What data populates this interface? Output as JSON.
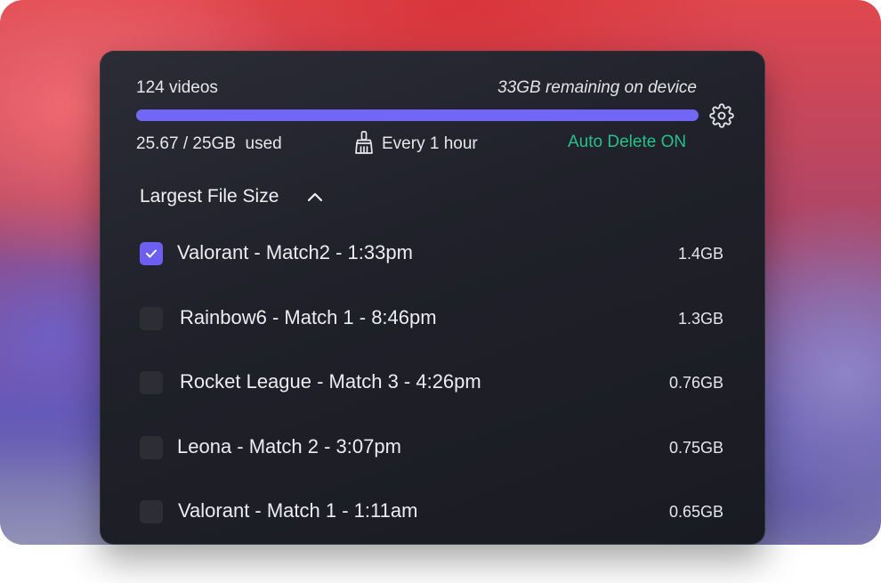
{
  "storage": {
    "video_count": "124 videos",
    "remaining": "33GB remaining on device",
    "used": "25.67 / 25GB  used",
    "usage_fraction": 1.0,
    "bar_color": "#7266f6"
  },
  "cleanup": {
    "frequency": "Every 1 hour",
    "auto_delete": "Auto Delete ON",
    "auto_delete_color": "#27c08a"
  },
  "sort": {
    "label": "Largest File Size",
    "icon": "chevron-up-icon"
  },
  "files": [
    {
      "name": "Valorant - Match2 - 1:33pm",
      "size": "1.4GB",
      "checked": true
    },
    {
      "name": "Rainbow6 - Match 1 - 8:46pm",
      "size": "1.3GB",
      "checked": false
    },
    {
      "name": "Rocket League - Match 3 - 4:26pm",
      "size": "0.76GB",
      "checked": false
    },
    {
      "name": "Leona - Match 2 - 3:07pm",
      "size": "0.75GB",
      "checked": false
    },
    {
      "name": "Valorant - Match 1 - 1:11am",
      "size": "0.65GB",
      "checked": false
    }
  ],
  "icons": {
    "settings": "gear-icon",
    "cleanup": "broom-icon",
    "checked": "checkmark-icon"
  }
}
